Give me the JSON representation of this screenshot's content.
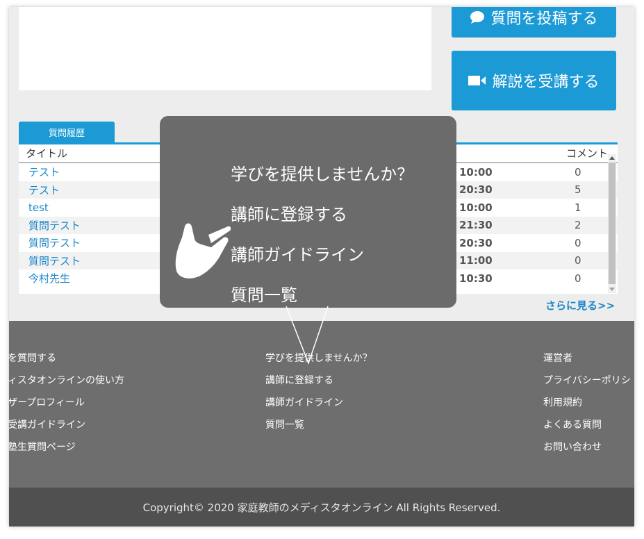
{
  "buttons": {
    "ask_question": "質問を投稿する",
    "take_lecture": "解説を受講する"
  },
  "history": {
    "tab_label": "質問履歴",
    "col_title": "タイトル",
    "col_comment": "コメント",
    "rows": [
      {
        "title": "テスト",
        "time": "10:00",
        "comments": "0"
      },
      {
        "title": "テスト",
        "time": "20:30",
        "comments": "5"
      },
      {
        "title": "test",
        "time": "10:00",
        "comments": "1"
      },
      {
        "title": "質問テスト",
        "time": "21:30",
        "comments": "2"
      },
      {
        "title": "質問テスト",
        "time": "20:30",
        "comments": "0"
      },
      {
        "title": "質問テスト",
        "time": "11:00",
        "comments": "0"
      },
      {
        "title": "今村先生",
        "time": "10:30",
        "comments": "0"
      }
    ],
    "more_link": "さらに見る>>"
  },
  "tooltip": {
    "items": [
      "学びを提供しませんか？",
      "講師に登録する",
      "講師ガイドライン",
      "質問一覧"
    ]
  },
  "footer": {
    "col1": [
      "を質問する",
      "ィスタオンラインの使い方",
      "ザープロフィール",
      "受講ガイドライン",
      "塾生質問ページ"
    ],
    "col2": [
      "学びを提供しませんか？",
      "講師に登録する",
      "講師ガイドライン",
      "質問一覧"
    ],
    "col3": [
      "運営者",
      "プライバシーポリシ",
      "利用規約",
      "よくある質問",
      "お問い合わせ"
    ],
    "copyright": "Copyright© 2020 家庭教師のメディスタオンライン All Rights Reserved."
  },
  "colors": {
    "accent": "#1b9ad6",
    "link": "#1b85c8",
    "footer_bg": "#6e6e6e",
    "copyright_bg": "#505050",
    "tooltip_bg": "#6b6b6b"
  }
}
